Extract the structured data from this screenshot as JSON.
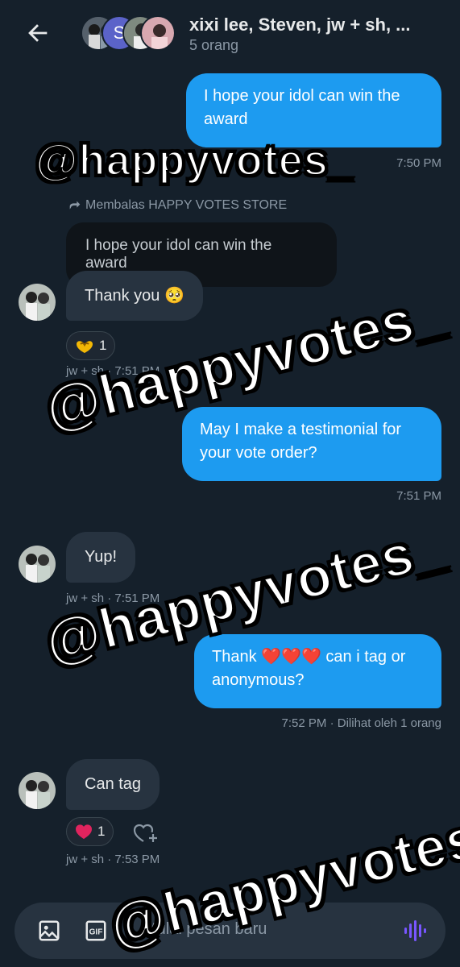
{
  "header": {
    "title": "xixi lee, Steven, jw + sh, ...",
    "subtitle": "5 orang",
    "avatar_letter": "S"
  },
  "messages": {
    "m1": {
      "text": "I hope your idol can win the award",
      "time": "7:50 PM"
    },
    "reply": {
      "note": "Membalas HAPPY VOTES STORE",
      "quoted": "I hope your idol can win the award",
      "text": "Thank you 🥺",
      "reaction_count": "1",
      "meta": "jw + sh · 7:51 PM"
    },
    "m3": {
      "text": "May I make a testimonial for your vote order?",
      "time": "7:51 PM"
    },
    "m4": {
      "text": "Yup!",
      "meta": "jw + sh · 7:51 PM"
    },
    "m5": {
      "text_before": "Thank ",
      "hearts": "❤️❤️❤️",
      "text_after": " can i tag or anonymous?",
      "time": "7:52 PM · Dilihat oleh 1 orang"
    },
    "m6": {
      "text": "Can tag",
      "reaction_count": "1",
      "meta": "jw + sh · 7:53 PM"
    }
  },
  "watermark": "@happyvotes_",
  "composer": {
    "placeholder": "Mulai pesan baru"
  },
  "colors": {
    "background": "#15202b",
    "outgoing": "#1d9bf0",
    "incoming": "#273340",
    "accent_voice": "#7856ff"
  }
}
